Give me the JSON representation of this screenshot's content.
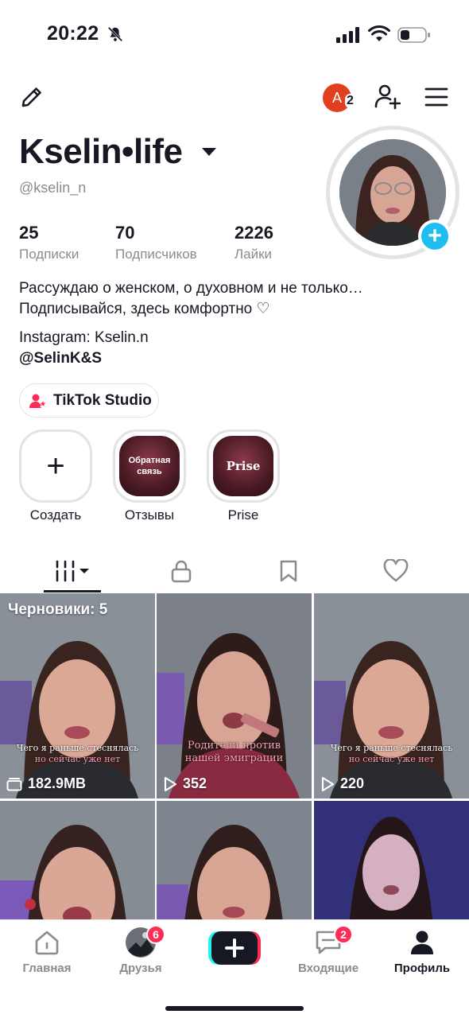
{
  "status_bar": {
    "time": "20:22"
  },
  "header": {
    "account_initial": "A",
    "account_count": "2"
  },
  "profile": {
    "display_name": "Kselin•life",
    "handle": "@kselin_n",
    "stats": [
      {
        "value": "25",
        "label": "Подписки"
      },
      {
        "value": "70",
        "label": "Подписчиков"
      },
      {
        "value": "2226",
        "label": "Лайки"
      }
    ],
    "bio_line1": "Рассуждаю о женском, о духовном и не только…",
    "bio_line2": "Подписывайся, здесь комфортно ♡",
    "instagram": "Instagram: Kselin.n",
    "mention": "@SelinK&S",
    "studio_button": "TikTok Studio"
  },
  "highlights": [
    {
      "label": "Создать",
      "inner": "+"
    },
    {
      "label": "Отзывы",
      "inner": "Обратная связь"
    },
    {
      "label": "Prise",
      "inner": "Prise"
    }
  ],
  "grid": {
    "drafts_label": "Черновики: 5",
    "videos": [
      {
        "caption_line1": "Чего я раньше стеснялась",
        "caption_line2": "но сейчас уже нет",
        "meta": "182.9MB",
        "meta_icon": "drafts-icon"
      },
      {
        "caption_line1": "Родители против",
        "caption_line2": "нашей эмиграции",
        "meta": "352",
        "meta_icon": "play-icon"
      },
      {
        "caption_line1": "Чего я раньше стеснялась",
        "caption_line2": "но сейчас уже нет",
        "meta": "220",
        "meta_icon": "play-icon"
      }
    ]
  },
  "bottom_nav": {
    "items": [
      {
        "label": "Главная"
      },
      {
        "label": "Друзья",
        "badge": "6"
      },
      {
        "label": "Входящие",
        "badge": "2"
      },
      {
        "label": "Профиль"
      }
    ]
  },
  "colors": {
    "accent_cyan": "#20bef0",
    "accent_red": "#fe2c55",
    "text": "#161823",
    "muted": "#8a8b91"
  }
}
